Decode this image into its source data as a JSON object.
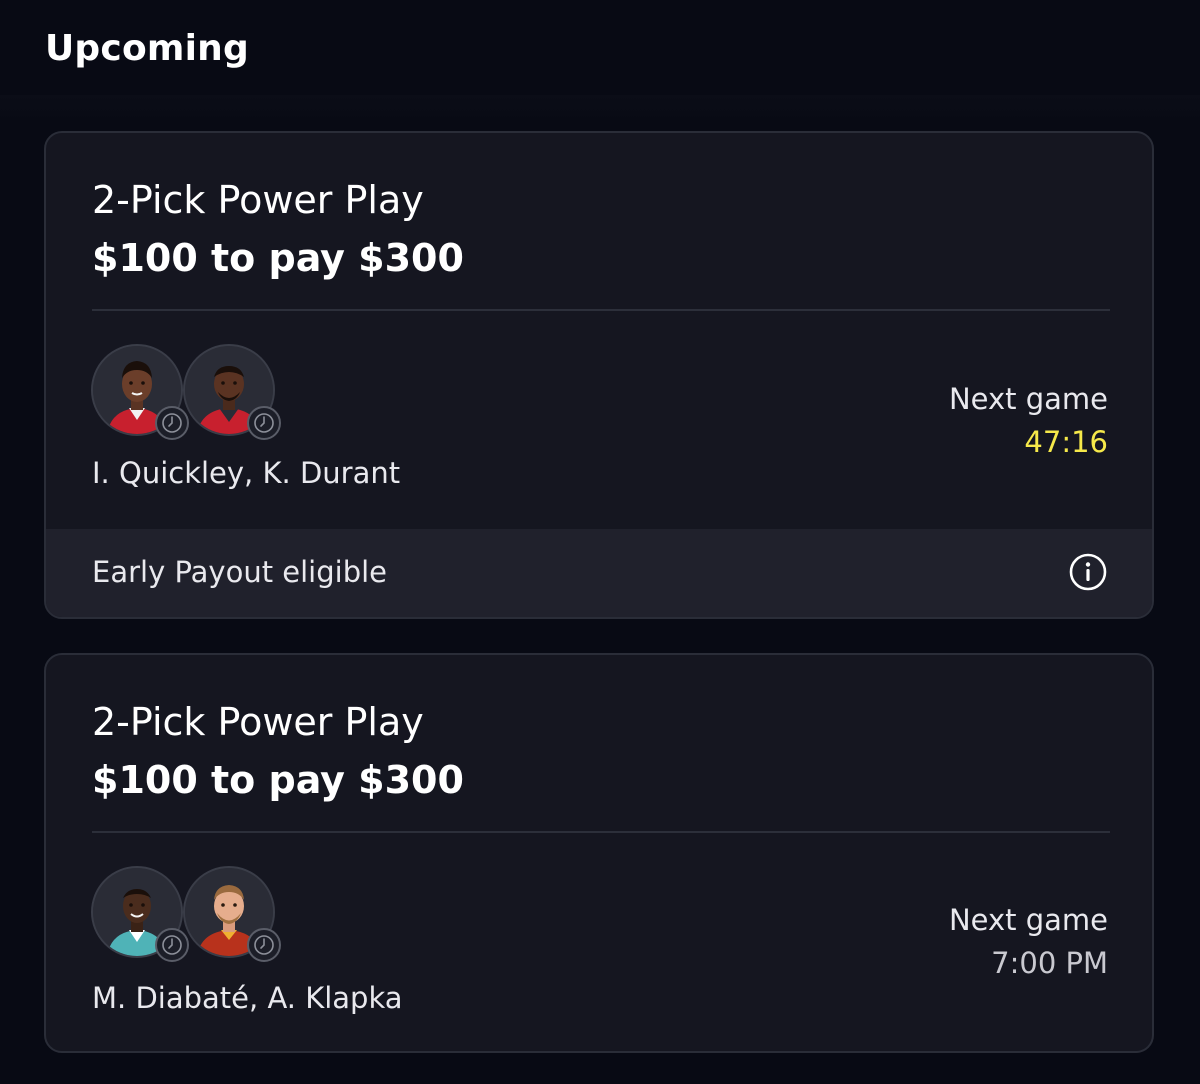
{
  "section": {
    "title": "Upcoming"
  },
  "colors": {
    "background": "#080a14",
    "card": "#151620",
    "card_border": "#2a2d38",
    "countdown": "#f6e94a",
    "scheduled_time": "#c9c9d0",
    "early_bar": "#20212c"
  },
  "entries": [
    {
      "type": "2-Pick Power Play",
      "payout": "$100 to pay $300",
      "players": "I. Quickley, K. Durant",
      "next_label": "Next game",
      "next_value": "47:16",
      "early_payout": {
        "label": "Early Payout eligible",
        "icon": "info-icon"
      },
      "avatar_icons": [
        "player-avatar",
        "player-avatar"
      ],
      "status_icons": [
        "clock-icon",
        "clock-icon"
      ]
    },
    {
      "type": "2-Pick Power Play",
      "payout": "$100 to pay $300",
      "players": "M. Diabaté, A. Klapka",
      "next_label": "Next game",
      "next_value": "7:00 PM",
      "avatar_icons": [
        "player-avatar",
        "player-avatar"
      ],
      "status_icons": [
        "clock-icon",
        "clock-icon"
      ]
    }
  ]
}
